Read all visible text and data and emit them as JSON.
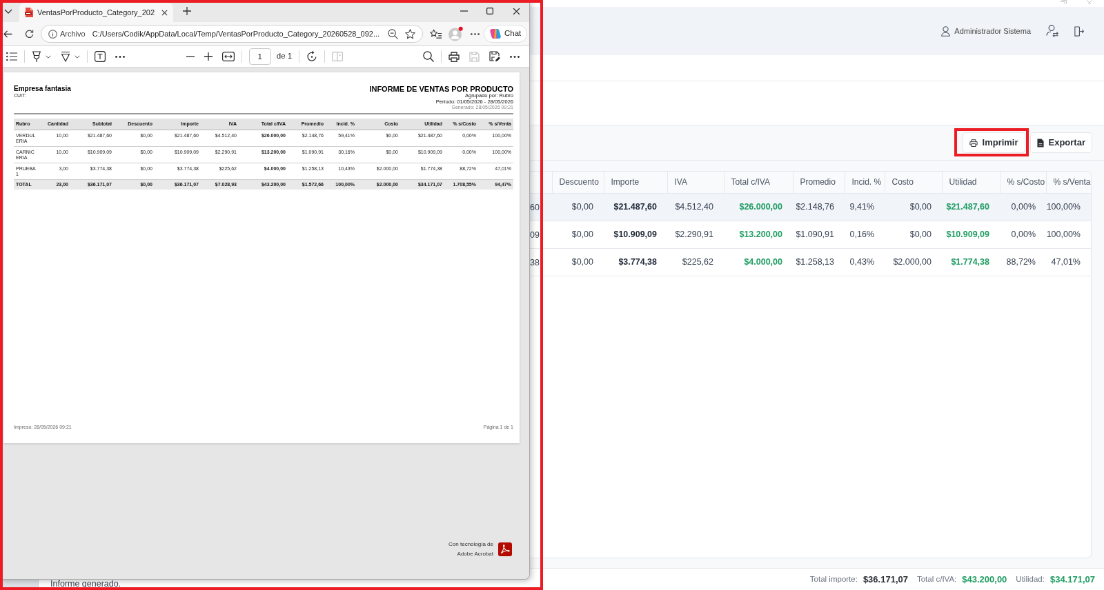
{
  "pdf_viewer": {
    "highlighted": true,
    "tabs": [
      {
        "title": "VentasPorProducto_Category_202",
        "selected": true
      }
    ],
    "address_bar": {
      "label": "Archivo",
      "url": "C:/Users/Codik/AppData/Local/Temp/VentasPorProducto_Category_20260528_092..."
    },
    "chat_button": {
      "label": "Chat"
    },
    "toolbar": {
      "start": [
        [
          {
            "kind": "contents",
            "disabled": false
          }
        ],
        [
          {
            "kind": "highlight",
            "disabled": false
          },
          {
            "kind": "draw",
            "disabled": false
          }
        ],
        [
          {
            "kind": "text_box",
            "disabled": false
          },
          {
            "kind": "more",
            "disabled": false
          }
        ]
      ],
      "middle": [
        [
          {
            "kind": "zoom_out",
            "disabled": false
          },
          {
            "kind": "zoom_in",
            "disabled": false
          },
          {
            "kind": "fit_width",
            "disabled": false
          }
        ],
        [
          {
            "kind": "page_input",
            "disabled": false,
            "value": "1",
            "suffix": "de 1"
          }
        ],
        [
          {
            "kind": "rotate",
            "disabled": false
          }
        ],
        [
          {
            "kind": "page_view",
            "disabled": true
          }
        ]
      ],
      "end": [
        [
          {
            "kind": "search",
            "disabled": false
          }
        ],
        [
          {
            "kind": "print",
            "disabled": false
          },
          {
            "kind": "save",
            "disabled": true
          },
          {
            "kind": "save_as",
            "disabled": false
          },
          {
            "kind": "more",
            "disabled": false
          }
        ]
      ]
    },
    "document": {
      "company": "Empresa fantasia",
      "tax_id_label": "CUIT:",
      "title": "INFORME DE VENTAS POR PRODUCTO",
      "subtitle_lines": [
        "Agrupado por: Rubro",
        "Período: 01/05/2026 - 28/05/2026"
      ],
      "generated": "Generado: 28/05/2026 09:21",
      "table": {
        "columns": [
          {
            "label": "Rubro",
            "kind": "label"
          },
          {
            "label": "Cantidad",
            "kind": "number"
          },
          {
            "label": "Subtotal",
            "kind": "number"
          },
          {
            "label": "Descuento",
            "kind": "number"
          },
          {
            "label": "Importe",
            "kind": "number"
          },
          {
            "label": "IVA",
            "kind": "number"
          },
          {
            "label": "Total c/IVA",
            "kind": "strong"
          },
          {
            "label": "Promedio",
            "kind": "number"
          },
          {
            "label": "Incid. %",
            "kind": "number"
          },
          {
            "label": "Costo",
            "kind": "number"
          },
          {
            "label": "Utilidad",
            "kind": "number"
          },
          {
            "label": "% s/Costo",
            "kind": "number"
          },
          {
            "label": "% s/Venta",
            "kind": "number"
          }
        ],
        "rows": [
          {
            "cells": [
              "VERDULERIA",
              "10,00",
              "$21.487,60",
              "$0,00",
              "$21.487,60",
              "$4.512,40",
              "$26.000,00",
              "$2.148,76",
              "59,41%",
              "$0,00",
              "$21.487,60",
              "0,00%",
              "100,00%"
            ]
          },
          {
            "cells": [
              "CARNICERIA",
              "10,00",
              "$10.909,09",
              "$0,00",
              "$10.909,09",
              "$2.290,91",
              "$13.200,00",
              "$1.090,91",
              "30,16%",
              "$0,00",
              "$10.909,09",
              "0,00%",
              "100,00%"
            ]
          },
          {
            "cells": [
              "PRUEBA 1",
              "3,00",
              "$3.774,38",
              "$0,00",
              "$3.774,38",
              "$225,62",
              "$4.000,00",
              "$1.258,13",
              "10,43%",
              "$2.000,00",
              "$1.774,38",
              "88,72%",
              "47,01%"
            ]
          }
        ],
        "total_row": {
          "cells": [
            "TOTAL",
            "23,00",
            "$36.171,07",
            "$0,00",
            "$36.171,07",
            "$7.028,93",
            "$43.200,00",
            "$1.572,66",
            "100,00%",
            "$2.000,00",
            "$34.171,07",
            "1.708,55%",
            "94,47%"
          ]
        }
      },
      "footer": {
        "printed": "Impreso: 28/05/2026 09:21",
        "page": "Página 1 de 1"
      }
    },
    "branding": [
      "Con tecnología de",
      "Adobe Acrobat"
    ]
  },
  "app": {
    "user_name": "Administrador Sistema",
    "buttons": [
      {
        "label": "Imprimir",
        "kind": "print",
        "highlighted": true
      },
      {
        "label": "Exportar",
        "kind": "export",
        "highlighted": false
      }
    ],
    "table": {
      "columns": [
        {
          "label": "Descuento",
          "kind": "plain"
        },
        {
          "label": "Importe",
          "kind": "strong"
        },
        {
          "label": "IVA",
          "kind": "plain"
        },
        {
          "label": "Total c/IVA",
          "kind": "positive"
        },
        {
          "label": "Promedio",
          "kind": "plain"
        },
        {
          "label": "Incid. %",
          "kind": "plain"
        },
        {
          "label": "Costo",
          "kind": "plain"
        },
        {
          "label": "Utilidad",
          "kind": "positive"
        },
        {
          "label": "% s/Costo",
          "kind": "plain"
        },
        {
          "label": "% s/Venta",
          "kind": "plain"
        }
      ],
      "rows": [
        {
          "selected": true,
          "column_1": "60",
          "cells": [
            "$0,00",
            "$21.487,60",
            "$4.512,40",
            "$26.000,00",
            "$2.148,76",
            "9,41%",
            "$0,00",
            "$21.487,60",
            "0,00%",
            "100,00%"
          ]
        },
        {
          "selected": false,
          "column_1": "09",
          "cells": [
            "$0,00",
            "$10.909,09",
            "$2.290,91",
            "$13.200,00",
            "$1.090,91",
            "0,16%",
            "$0,00",
            "$10.909,09",
            "0,00%",
            "100,00%"
          ]
        },
        {
          "selected": false,
          "column_1": "38",
          "cells": [
            "$0,00",
            "$3.774,38",
            "$225,62",
            "$4.000,00",
            "$1.258,13",
            "0,43%",
            "$2.000,00",
            "$1.774,38",
            "88,72%",
            "47,01%"
          ]
        }
      ]
    },
    "status_message": "Informe generado.",
    "totals": [
      {
        "label": "Total importe:",
        "value": "$36.171,07",
        "kind": "plain"
      },
      {
        "label": "Total c/IVA:",
        "value": "$43.200,00",
        "kind": "positive"
      },
      {
        "label": "Utilidad:",
        "value": "$34.171,07",
        "kind": "positive"
      }
    ]
  }
}
